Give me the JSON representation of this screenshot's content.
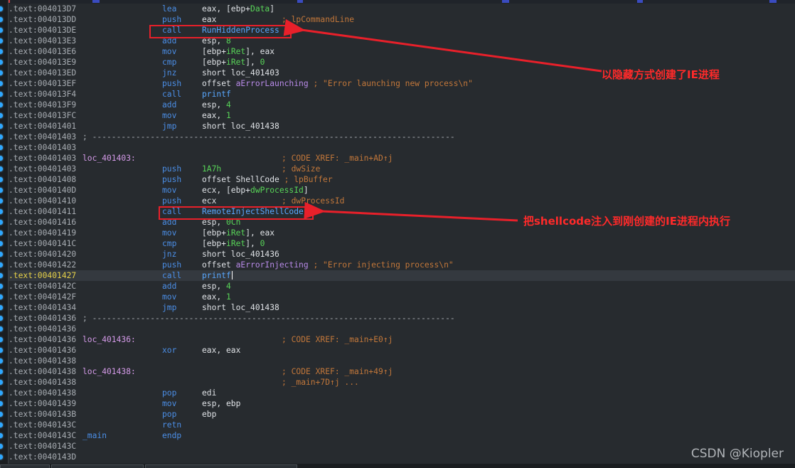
{
  "listing": [
    {
      "addr": ".text:004013D7",
      "mnem": "lea",
      "ops": [
        {
          "t": "eax, [ebp+"
        },
        {
          "t": "Data",
          "c": "sym"
        },
        {
          "t": "]"
        }
      ]
    },
    {
      "addr": ".text:004013DD",
      "mnem": "push",
      "ops": [
        {
          "t": "eax"
        }
      ],
      "comment": "; lpCommandLine",
      "comment_col": 384
    },
    {
      "addr": ".text:004013DE",
      "mnem": "call",
      "ops": [
        {
          "t": "RunHiddenProcess",
          "c": "call"
        }
      ]
    },
    {
      "addr": ".text:004013E3",
      "mnem": "add",
      "ops": [
        {
          "t": "esp, "
        },
        {
          "t": "8",
          "c": "sym"
        }
      ]
    },
    {
      "addr": ".text:004013E6",
      "mnem": "mov",
      "ops": [
        {
          "t": "[ebp+"
        },
        {
          "t": "iRet",
          "c": "sym"
        },
        {
          "t": "], eax"
        }
      ]
    },
    {
      "addr": ".text:004013E9",
      "mnem": "cmp",
      "ops": [
        {
          "t": "[ebp+"
        },
        {
          "t": "iRet",
          "c": "sym"
        },
        {
          "t": "], "
        },
        {
          "t": "0",
          "c": "sym"
        }
      ]
    },
    {
      "addr": ".text:004013ED",
      "mnem": "jnz",
      "ops": [
        {
          "t": "short loc_401403"
        }
      ]
    },
    {
      "addr": ".text:004013EF",
      "mnem": "push",
      "ops": [
        {
          "t": "offset "
        },
        {
          "t": "aErrorLaunching",
          "c": "off"
        },
        {
          "t": " "
        },
        {
          "t": "; \"Error launching new process\\n\"",
          "c": "cmt"
        }
      ]
    },
    {
      "addr": ".text:004013F4",
      "mnem": "call",
      "ops": [
        {
          "t": "printf",
          "c": "call"
        }
      ]
    },
    {
      "addr": ".text:004013F9",
      "mnem": "add",
      "ops": [
        {
          "t": "esp, "
        },
        {
          "t": "4",
          "c": "sym"
        }
      ]
    },
    {
      "addr": ".text:004013FC",
      "mnem": "mov",
      "ops": [
        {
          "t": "eax, "
        },
        {
          "t": "1",
          "c": "sym"
        }
      ]
    },
    {
      "addr": ".text:00401401",
      "mnem": "jmp",
      "ops": [
        {
          "t": "short loc_401438"
        }
      ]
    },
    {
      "addr": ".text:00401403",
      "sep": "; ---------------------------------------------------------------------------"
    },
    {
      "addr": ".text:00401403"
    },
    {
      "addr": ".text:00401403",
      "label": "loc_401403:",
      "comment": "; CODE XREF: _main+AD↑j",
      "comment_col": 384
    },
    {
      "addr": ".text:00401403",
      "mnem": "push",
      "ops": [
        {
          "t": "1A7h",
          "c": "sym"
        }
      ],
      "comment": "; dwSize",
      "comment_col": 384
    },
    {
      "addr": ".text:00401408",
      "mnem": "push",
      "ops": [
        {
          "t": "offset ShellCode "
        },
        {
          "t": "; lpBuffer",
          "c": "cmt"
        }
      ]
    },
    {
      "addr": ".text:0040140D",
      "mnem": "mov",
      "ops": [
        {
          "t": "ecx, [ebp+"
        },
        {
          "t": "dwProcessId",
          "c": "sym"
        },
        {
          "t": "]"
        }
      ]
    },
    {
      "addr": ".text:00401410",
      "mnem": "push",
      "ops": [
        {
          "t": "ecx"
        }
      ],
      "comment": "; dwProcessId",
      "comment_col": 384
    },
    {
      "addr": ".text:00401411",
      "mnem": "call",
      "ops": [
        {
          "t": "RemoteInjectShellCode",
          "c": "call"
        }
      ]
    },
    {
      "addr": ".text:00401416",
      "mnem": "add",
      "ops": [
        {
          "t": "esp, "
        },
        {
          "t": "0Ch",
          "c": "sym"
        }
      ]
    },
    {
      "addr": ".text:00401419",
      "mnem": "mov",
      "ops": [
        {
          "t": "[ebp+"
        },
        {
          "t": "iRet",
          "c": "sym"
        },
        {
          "t": "], eax"
        }
      ]
    },
    {
      "addr": ".text:0040141C",
      "mnem": "cmp",
      "ops": [
        {
          "t": "[ebp+"
        },
        {
          "t": "iRet",
          "c": "sym"
        },
        {
          "t": "], "
        },
        {
          "t": "0",
          "c": "sym"
        }
      ]
    },
    {
      "addr": ".text:00401420",
      "mnem": "jnz",
      "ops": [
        {
          "t": "short loc_401436"
        }
      ]
    },
    {
      "addr": ".text:00401422",
      "mnem": "push",
      "ops": [
        {
          "t": "offset "
        },
        {
          "t": "aErrorInjecting",
          "c": "off"
        },
        {
          "t": " "
        },
        {
          "t": "; \"Error injecting process\\n\"",
          "c": "cmt"
        }
      ]
    },
    {
      "addr": ".text:00401427",
      "mnem": "call",
      "ops": [
        {
          "t": "printf",
          "c": "call"
        }
      ],
      "current": true
    },
    {
      "addr": ".text:0040142C",
      "mnem": "add",
      "ops": [
        {
          "t": "esp, "
        },
        {
          "t": "4",
          "c": "sym"
        }
      ]
    },
    {
      "addr": ".text:0040142F",
      "mnem": "mov",
      "ops": [
        {
          "t": "eax, "
        },
        {
          "t": "1",
          "c": "sym"
        }
      ]
    },
    {
      "addr": ".text:00401434",
      "mnem": "jmp",
      "ops": [
        {
          "t": "short loc_401438"
        }
      ]
    },
    {
      "addr": ".text:00401436",
      "sep": "; ---------------------------------------------------------------------------"
    },
    {
      "addr": ".text:00401436"
    },
    {
      "addr": ".text:00401436",
      "label": "loc_401436:",
      "comment": "; CODE XREF: _main+E0↑j",
      "comment_col": 384
    },
    {
      "addr": ".text:00401436",
      "mnem": "xor",
      "ops": [
        {
          "t": "eax, eax"
        }
      ]
    },
    {
      "addr": ".text:00401438"
    },
    {
      "addr": ".text:00401438",
      "label": "loc_401438:",
      "comment": "; CODE XREF: _main+49↑j",
      "comment_col": 384
    },
    {
      "addr": ".text:00401438",
      "comment": "; _main+7D↑j ...",
      "comment_col": 384
    },
    {
      "addr": ".text:00401438",
      "mnem": "pop",
      "ops": [
        {
          "t": "edi"
        }
      ]
    },
    {
      "addr": ".text:00401439",
      "mnem": "mov",
      "ops": [
        {
          "t": "esp, ebp"
        }
      ]
    },
    {
      "addr": ".text:0040143B",
      "mnem": "pop",
      "ops": [
        {
          "t": "ebp"
        }
      ]
    },
    {
      "addr": ".text:0040143C",
      "mnem": "retn"
    },
    {
      "addr": ".text:0040143C",
      "label": "_main",
      "label_color": "#4b8ee6",
      "mnem": "endp"
    },
    {
      "addr": ".text:0040143C"
    },
    {
      "addr": ".text:0040143D"
    }
  ],
  "annotations": [
    {
      "text": "以隐藏方式创建了IE进程",
      "color": "#ff2a2a"
    },
    {
      "text": "把shellcode注入到刚创建的IE进程内执行",
      "color": "#ff2a2a"
    }
  ],
  "watermark": "CSDN @Kiopler",
  "colors": {
    "background": "#272b2f",
    "address": "#a8adb3",
    "mnemonic": "#4b8ee6",
    "label": "#d49ae8",
    "comment": "#c2773a",
    "symbol": "#58d558",
    "highlight_row": "#34393f",
    "annotation": "#e8202a"
  }
}
